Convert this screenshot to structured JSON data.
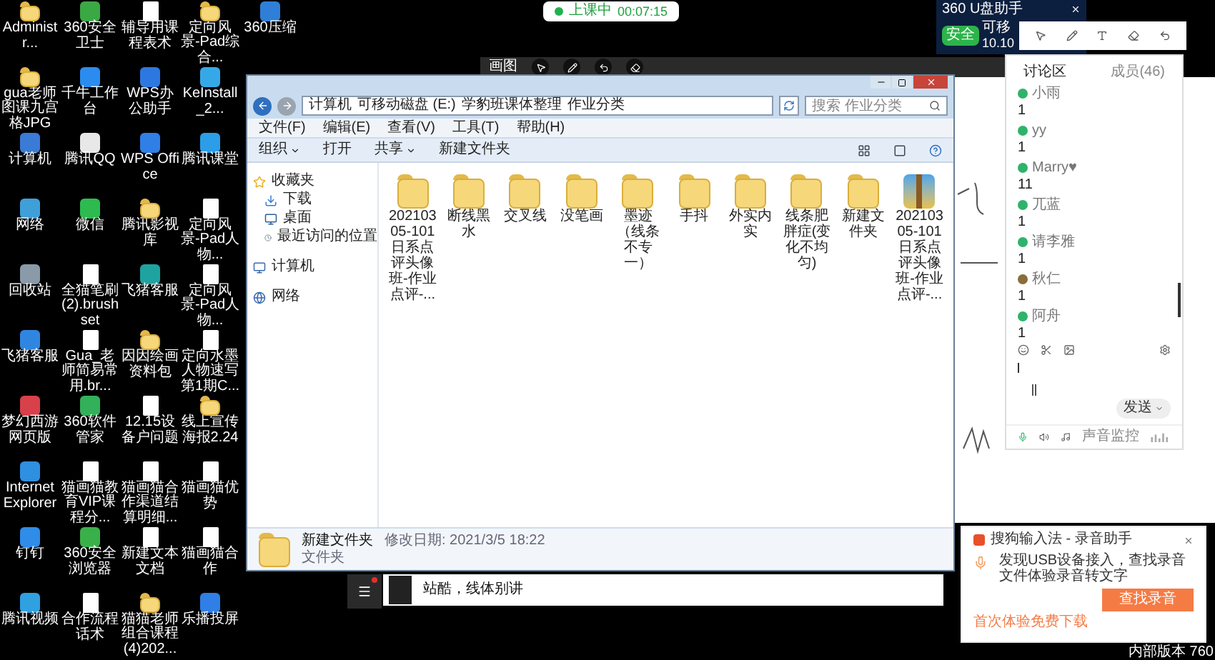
{
  "desktop_rows": [
    [
      {
        "label": "Administr...",
        "kind": "folder"
      },
      {
        "label": "360安全卫士",
        "kind": "app",
        "color": "#3aa845"
      },
      {
        "label": "辅导用课程表术",
        "kind": "file"
      },
      {
        "label": "定向风景-Pad综合...",
        "kind": "folder"
      },
      {
        "label": "360压缩",
        "kind": "app",
        "color": "#2f7fd8"
      }
    ],
    [
      {
        "label": "gua老师图课九宫格JPG",
        "kind": "folder"
      },
      {
        "label": "千牛工作台",
        "kind": "app",
        "color": "#2b8cf0"
      },
      {
        "label": "WPS办公助手",
        "kind": "app",
        "color": "#2d78e0"
      },
      {
        "label": "KeInstall_2...",
        "kind": "app",
        "color": "#35a9e8"
      }
    ],
    [
      {
        "label": "计算机",
        "kind": "app",
        "color": "#3a7bd5"
      },
      {
        "label": "腾讯QQ",
        "kind": "app",
        "color": "#e8e8e8"
      },
      {
        "label": "WPS Office",
        "kind": "app",
        "color": "#2f7fe6"
      },
      {
        "label": "腾讯课堂",
        "kind": "app",
        "color": "#2c9de8"
      }
    ],
    [
      {
        "label": "网络",
        "kind": "app",
        "color": "#3f9fd8"
      },
      {
        "label": "微信",
        "kind": "app",
        "color": "#2dbb4f"
      },
      {
        "label": "腾讯影视库",
        "kind": "folder"
      },
      {
        "label": "定向风景-Pad人物...",
        "kind": "file"
      }
    ],
    [
      {
        "label": "回收站",
        "kind": "app",
        "color": "#8a9aa8"
      },
      {
        "label": "全猫笔刷(2).brushset",
        "kind": "file"
      },
      {
        "label": "飞猪客服",
        "kind": "app",
        "color": "#1fa3a0"
      },
      {
        "label": "定向风景-Pad人物...",
        "kind": "file"
      }
    ],
    [
      {
        "label": "飞猪客服",
        "kind": "app",
        "color": "#2f86e0"
      },
      {
        "label": "Gua_老师简易常用.br...",
        "kind": "file"
      },
      {
        "label": "因因绘画资料包",
        "kind": "folder"
      },
      {
        "label": "定向水墨人物速写第1期C...",
        "kind": "file"
      }
    ],
    [
      {
        "label": "梦幻西游网页版",
        "kind": "app",
        "color": "#d8404a"
      },
      {
        "label": "360软件管家",
        "kind": "app",
        "color": "#33b05a"
      },
      {
        "label": "12.15设备户问题",
        "kind": "file"
      },
      {
        "label": "线上宣传海报2.24",
        "kind": "folder"
      }
    ],
    [
      {
        "label": "Internet Explorer",
        "kind": "app",
        "color": "#2f8fe0"
      },
      {
        "label": "猫画猫教育VIP课程分...",
        "kind": "file"
      },
      {
        "label": "猫画猫合作渠道结算明细...",
        "kind": "file"
      },
      {
        "label": "猫画猫优势",
        "kind": "file"
      }
    ],
    [
      {
        "label": "钉钉",
        "kind": "app",
        "color": "#2f8ce8"
      },
      {
        "label": "360安全浏览器",
        "kind": "app",
        "color": "#3ab04a"
      },
      {
        "label": "新建文本文档",
        "kind": "file"
      },
      {
        "label": "猫画猫合作",
        "kind": "file"
      }
    ],
    [
      {
        "label": "腾讯视频",
        "kind": "app",
        "color": "#2fa0e0"
      },
      {
        "label": "合作流程话术",
        "kind": "file"
      },
      {
        "label": "猫猫老师组合课程(4)202...",
        "kind": "folder"
      },
      {
        "label": "乐播投屏",
        "kind": "app",
        "color": "#2f7fe6"
      }
    ]
  ],
  "class_status": {
    "label": "上课中",
    "time": "00:07:15"
  },
  "usb_notice": {
    "title": "360 U盘助手",
    "button": "安全",
    "line_1": "可移",
    "line_2": "10.10"
  },
  "whiteboard_toolbar": {
    "label": "画图"
  },
  "explorer": {
    "breadcrumb": [
      "计算机",
      "可移动磁盘 (E:)",
      "学豹班课体整理",
      "作业分类"
    ],
    "search_placeholder": "搜索 作业分类",
    "menu": [
      "文件(F)",
      "编辑(E)",
      "查看(V)",
      "工具(T)",
      "帮助(H)"
    ],
    "toolbar": [
      {
        "label": "组织",
        "dropdown": true
      },
      {
        "label": "打开",
        "dropdown": false
      },
      {
        "label": "共享",
        "dropdown": true
      },
      {
        "label": "新建文件夹",
        "dropdown": false
      }
    ],
    "sidebar": [
      {
        "label": "收藏夹",
        "kind": "favorites",
        "children": [
          {
            "label": "下载",
            "kind": "download"
          },
          {
            "label": "桌面",
            "kind": "desktop"
          },
          {
            "label": "最近访问的位置",
            "kind": "recent"
          }
        ]
      },
      {
        "label": "计算机",
        "kind": "computer"
      },
      {
        "label": "网络",
        "kind": "network"
      }
    ],
    "files": [
      {
        "label": "20210305-101日系点评头像班-作业点评-...",
        "kind": "folder"
      },
      {
        "label": "断线黑水",
        "kind": "folder"
      },
      {
        "label": "交叉线",
        "kind": "folder"
      },
      {
        "label": "没笔画",
        "kind": "folder"
      },
      {
        "label": "墨迹（线条不专一）",
        "kind": "folder"
      },
      {
        "label": "手抖",
        "kind": "folder"
      },
      {
        "label": "外实内实",
        "kind": "folder"
      },
      {
        "label": "线条肥胖症(变化不均匀)",
        "kind": "folder"
      },
      {
        "label": "新建文件夹",
        "kind": "folder"
      },
      {
        "label": "20210305-101日系点评头像班-作业点评-...",
        "kind": "archive"
      }
    ],
    "details": {
      "name": "新建文件夹",
      "modified": "修改日期: 2021/3/5 18:22",
      "type": "文件夹"
    }
  },
  "chat": {
    "title": "讨论区",
    "members": "成员(46)",
    "messages": [
      {
        "name": "小雨",
        "text": "1",
        "color": "#2fb36b"
      },
      {
        "name": "yy",
        "text": "1",
        "color": "#2fb36b"
      },
      {
        "name": "Marry♥",
        "text": "11",
        "color": "#2fb36b"
      },
      {
        "name": "兀蓝",
        "text": "1",
        "color": "#2fb36b"
      },
      {
        "name": "请李雅",
        "text": "1",
        "color": "#2fb36b"
      },
      {
        "name": "秋仁",
        "text": "1",
        "color": "#8a6d3b"
      },
      {
        "name": "阿舟",
        "text": "1",
        "color": "#2fb36b"
      }
    ],
    "send_button": "发送",
    "footer_label": "声音监控"
  },
  "media_bar": {
    "caption": "站酷，线体别讲"
  },
  "sogou_popup": {
    "title": "搜狗输入法 - 录音助手",
    "message": "发现USB设备接入，查找录音文件体验录音转文字",
    "button": "查找录音",
    "footer": "首次体验免费下载"
  },
  "corner_text": "内部版本 760"
}
